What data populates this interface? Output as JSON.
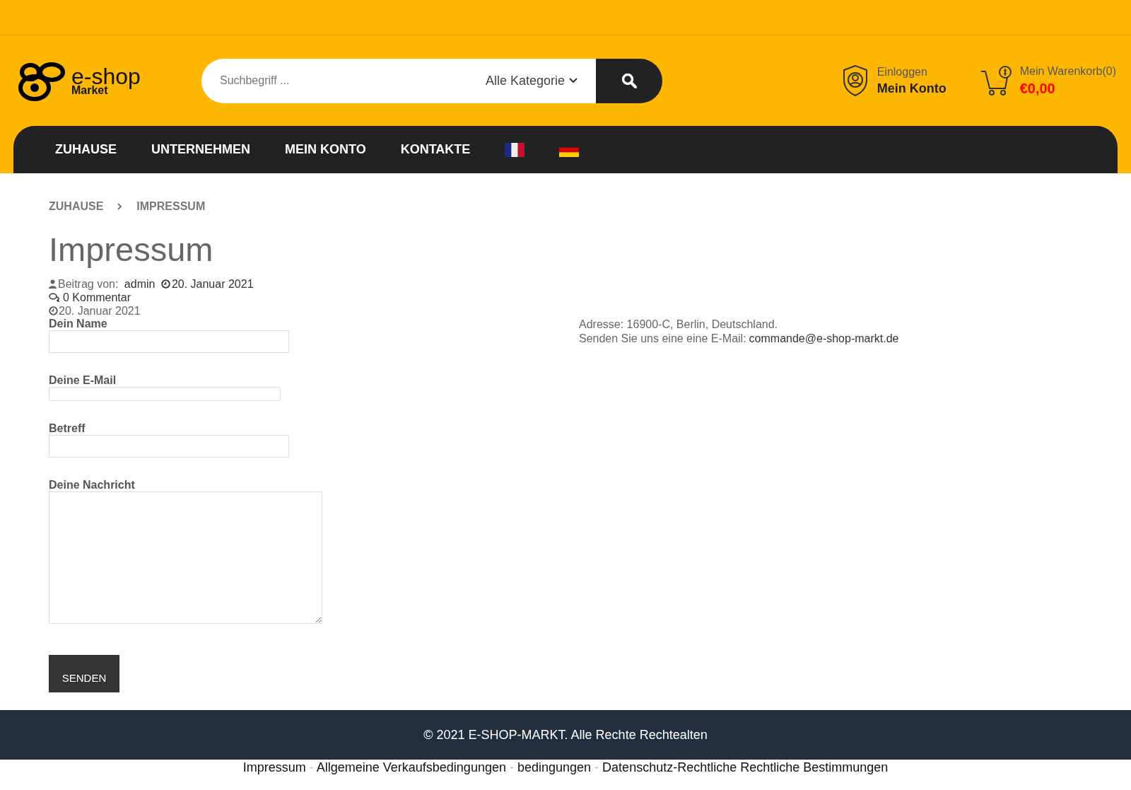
{
  "header": {
    "logo": {
      "title": "e-shop",
      "subtitle": "Market"
    },
    "search": {
      "placeholder": "Suchbegriff ...",
      "category": "Alle Kategorie"
    },
    "account": {
      "label": "Einloggen",
      "title": "Mein Konto"
    },
    "cart": {
      "label": "Mein Warenkorb(0)",
      "total": "€0,00"
    }
  },
  "nav": {
    "items": [
      "ZUHAUSE",
      "UNTERNEHMEN",
      "MEIN KONTO",
      "KONTAKTE"
    ],
    "flags": [
      {
        "kind": "fr"
      },
      {
        "kind": "de"
      }
    ]
  },
  "breadcrumb": [
    "ZUHAUSE",
    "IMPRESSUM"
  ],
  "page": {
    "title": "Impressum",
    "meta": {
      "by_label": "Beitrag von:",
      "author": "admin",
      "date": "20. Januar 2021",
      "comments": "0 Kommentar",
      "date2": "20. Januar 2021"
    }
  },
  "form": {
    "fields": [
      {
        "label": "Dein Name",
        "kind": "text"
      },
      {
        "label": "Deine E-Mail",
        "kind": "email"
      },
      {
        "label": "Betreff",
        "kind": "text"
      },
      {
        "label": "Deine Nachricht",
        "kind": "textarea"
      }
    ],
    "submit": "SENDEN"
  },
  "contact": {
    "address": "Adresse: 16900-C, Berlin, Deutschland.",
    "email_label": "Senden Sie uns eine eine E-Mail:",
    "email": "commande@e-shop-markt.de"
  },
  "footer": {
    "copyright": "© 2021 E-SHOP-MARKT. Alle Rechte Rechtealten",
    "links": [
      "Impressum",
      "Allgemeine Verkaufsbedingungen",
      "bedingungen",
      "Datenschutz-Rechtliche Rechtliche Bestimmungen"
    ],
    "separator": "-"
  }
}
